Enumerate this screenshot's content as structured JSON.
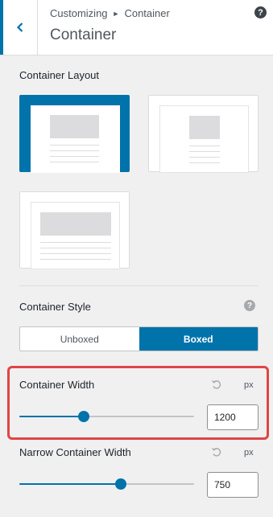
{
  "header": {
    "breadcrumb_root": "Customizing",
    "breadcrumb_current": "Container",
    "title": "Container",
    "help": "?"
  },
  "container_layout": {
    "label": "Container Layout",
    "options": [
      "full-width-boxed",
      "contained",
      "narrow"
    ],
    "selected": "full-width-boxed"
  },
  "container_style": {
    "label": "Container Style",
    "help": "?",
    "options": [
      {
        "label": "Unboxed",
        "active": false
      },
      {
        "label": "Boxed",
        "active": true
      }
    ]
  },
  "container_width": {
    "label": "Container Width",
    "unit": "px",
    "value": "1200",
    "slider_fraction": 0.37
  },
  "narrow_container_width": {
    "label": "Narrow Container Width",
    "unit": "px",
    "value": "750",
    "slider_fraction": 0.58
  },
  "colors": {
    "accent": "#0073aa",
    "highlight": "#e04545"
  }
}
